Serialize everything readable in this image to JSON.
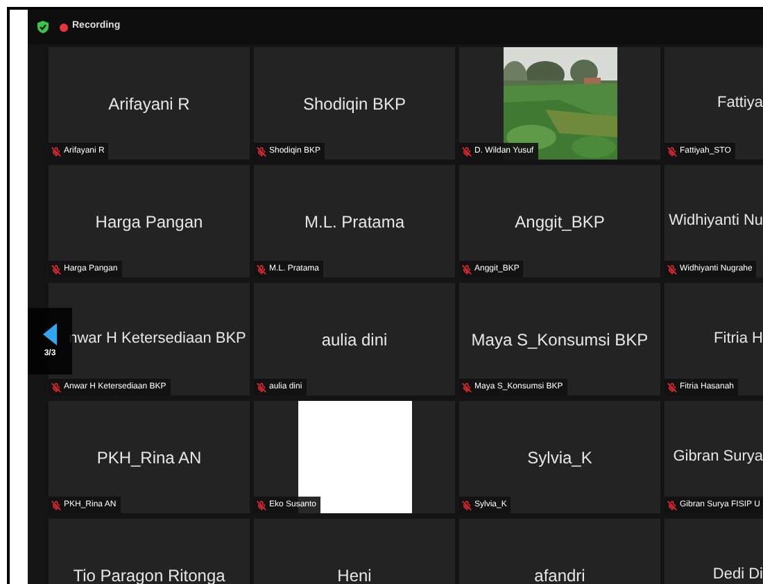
{
  "top_bar": {
    "secure": true,
    "recording": {
      "label": "Recording"
    }
  },
  "pager": {
    "label": "3/3"
  },
  "rows": [
    {
      "tiles": [
        {
          "kind": "avatar",
          "name": "Arifayani R",
          "label": "Arifayani R",
          "muted": true
        },
        {
          "kind": "avatar",
          "name": "Shodiqin BKP",
          "label": "Shodiqin BKP",
          "muted": true
        },
        {
          "kind": "picture",
          "label": "D. Wildan Yusuf",
          "muted": true
        },
        {
          "kind": "avatar",
          "name": "Fattiya",
          "label": "Fattiyah_STO",
          "muted": true
        }
      ]
    },
    {
      "tiles": [
        {
          "kind": "avatar",
          "name": "Harga Pangan",
          "label": "Harga Pangan",
          "muted": true
        },
        {
          "kind": "avatar",
          "name": "M.L. Pratama",
          "label": "M.L. Pratama",
          "muted": true
        },
        {
          "kind": "avatar",
          "name": "Anggit_BKP",
          "label": "Anggit_BKP",
          "muted": true
        },
        {
          "kind": "avatar",
          "name": "Widhiyanti Nu",
          "label": "Widhiyanti Nugrahe",
          "muted": true
        }
      ]
    },
    {
      "tiles": [
        {
          "kind": "avatar",
          "name": "nwar H Ketersediaan BKP",
          "label": "Anwar H Ketersediaan BKP",
          "muted": true
        },
        {
          "kind": "avatar",
          "name": "aulia dini",
          "label": "aulia dini",
          "muted": true
        },
        {
          "kind": "avatar",
          "name": "Maya S_Konsumsi BKP",
          "label": "Maya S_Konsumsi BKP",
          "muted": true
        },
        {
          "kind": "avatar",
          "name": "Fitria H",
          "label": "Fitria Hasanah",
          "muted": true
        }
      ]
    },
    {
      "tiles": [
        {
          "kind": "avatar",
          "name": "PKH_Rina AN",
          "label": "PKH_Rina AN",
          "muted": true
        },
        {
          "kind": "blank",
          "label": "Eko Susanto",
          "muted": true
        },
        {
          "kind": "avatar",
          "name": "Sylvia_K",
          "label": "Sylvia_K",
          "muted": true
        },
        {
          "kind": "avatar",
          "name": "Gibran Surya",
          "label": "Gibran Surya FISIP U",
          "muted": true
        }
      ]
    },
    {
      "tiles": [
        {
          "kind": "avatar",
          "name": "Tio Paragon Ritonga"
        },
        {
          "kind": "avatar",
          "name": "Heni"
        },
        {
          "kind": "avatar",
          "name": "afandri"
        },
        {
          "kind": "avatar",
          "name": "Dedi Di"
        }
      ]
    }
  ]
}
